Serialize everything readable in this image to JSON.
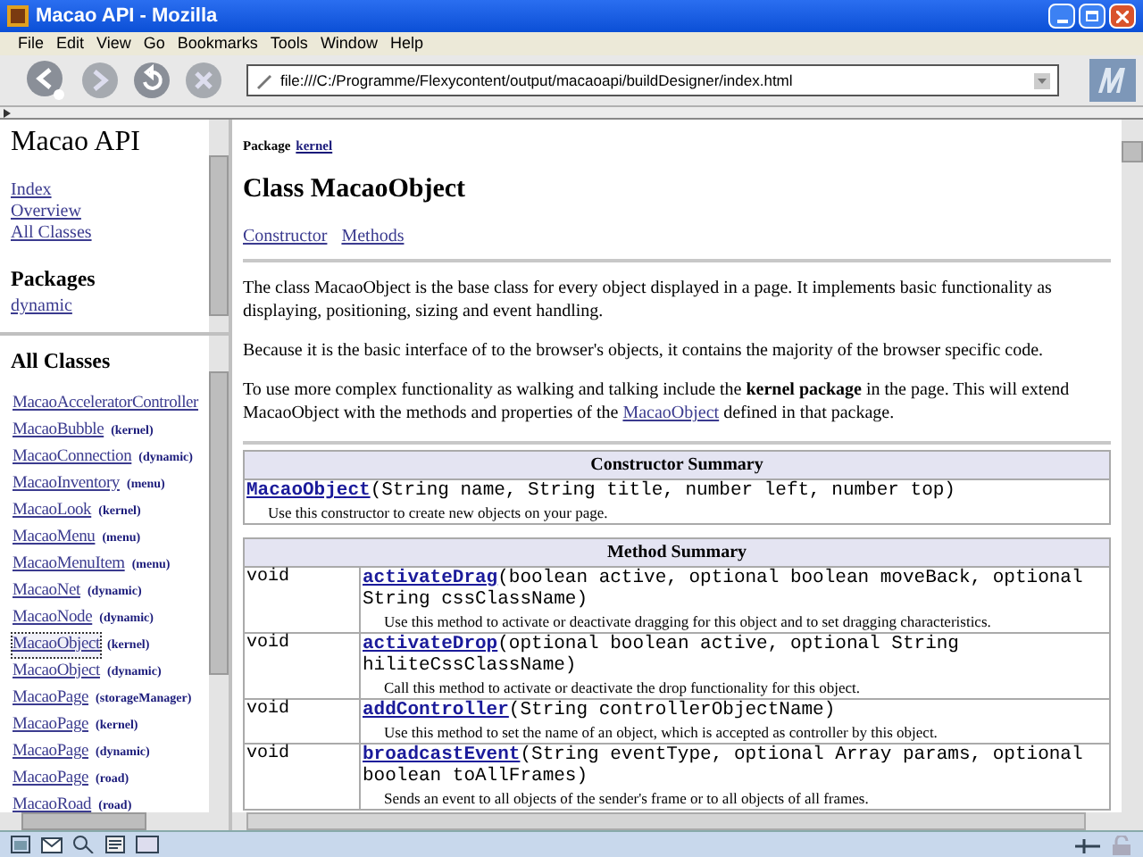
{
  "window": {
    "title": "Macao API - Mozilla"
  },
  "menu": [
    "File",
    "Edit",
    "View",
    "Go",
    "Bookmarks",
    "Tools",
    "Window",
    "Help"
  ],
  "toolbar": {
    "address": "file:///C:/Programme/Flexycontent/output/macaoapi/buildDesigner/index.html"
  },
  "nav_frame": {
    "title": "Macao API",
    "links": [
      "Index",
      "Overview",
      "All Classes"
    ],
    "packages_heading": "Packages",
    "packages": [
      "dynamic"
    ]
  },
  "classes_frame": {
    "heading": "All Classes",
    "classes": [
      {
        "name": "MacaoAcceleratorController",
        "selected": false
      },
      {
        "name": "MacaoBubble",
        "package": "(kernel)",
        "selected": false
      },
      {
        "name": "MacaoConnection",
        "package": "(dynamic)",
        "selected": false
      },
      {
        "name": "MacaoInventory",
        "package": "(menu)",
        "selected": false
      },
      {
        "name": "MacaoLook",
        "package": "(kernel)",
        "selected": false
      },
      {
        "name": "MacaoMenu",
        "package": "(menu)",
        "selected": false
      },
      {
        "name": "MacaoMenuItem",
        "package": "(menu)",
        "selected": false
      },
      {
        "name": "MacaoNet",
        "package": "(dynamic)",
        "selected": false
      },
      {
        "name": "MacaoNode",
        "package": "(dynamic)",
        "selected": false
      },
      {
        "name": "MacaoObject",
        "package": "(kernel)",
        "selected": true
      },
      {
        "name": "MacaoObject",
        "package": "(dynamic)",
        "selected": false
      },
      {
        "name": "MacaoPage",
        "package": "(storageManager)",
        "selected": false
      },
      {
        "name": "MacaoPage",
        "package": "(kernel)",
        "selected": false
      },
      {
        "name": "MacaoPage",
        "package": "(dynamic)",
        "selected": false
      },
      {
        "name": "MacaoPage",
        "package": "(road)",
        "selected": false
      },
      {
        "name": "MacaoRoad",
        "package": "(road)",
        "selected": false
      }
    ]
  },
  "content": {
    "package_label": "Package",
    "package": "kernel",
    "title": "Class MacaoObject",
    "anchors": [
      "Constructor",
      "Methods"
    ],
    "paragraphs": [
      [
        {
          "kind": "text",
          "text": "The class MacaoObject is the base class for every object displayed in a page. It implements basic functionality as displaying, positioning, sizing and event handling."
        }
      ],
      [
        {
          "kind": "text",
          "text": "Because it is the basic interface of to the browser's objects, it contains the majority of the browser specific code."
        }
      ],
      [
        {
          "kind": "text",
          "text": "To use more complex functionality as walking and talking include the **kernel package** in the page. This will extend MacaoObject with the methods and properties of the "
        },
        {
          "kind": "link",
          "text": "MacaoObject"
        },
        {
          "kind": "text",
          "text": " defined in that package."
        }
      ]
    ],
    "constructor_summary": {
      "heading": "Constructor Summary",
      "rows": [
        {
          "name": "MacaoObject",
          "params": "(String name, String title, number left, number top)",
          "description": "Use this constructor to create new objects on your page."
        }
      ]
    },
    "method_summary": {
      "heading": "Method Summary",
      "rows": [
        {
          "type": "void",
          "name": "activateDrag",
          "params": "(boolean active, optional boolean moveBack, optional String cssClassName)",
          "description": "Use this method to activate or deactivate dragging for this object and to set dragging characteristics."
        },
        {
          "type": "void",
          "name": "activateDrop",
          "params": "(optional boolean active, optional String hiliteCssClassName)",
          "description": "Call this method to activate or deactivate the drop functionality for this object."
        },
        {
          "type": "void",
          "name": "addController",
          "params": "(String controllerObjectName)",
          "description": "Use this method to set the name of an object, which is accepted as controller by this object."
        },
        {
          "type": "void",
          "name": "broadcastEvent",
          "params": "(String eventType, optional Array params, optional boolean toAllFrames)",
          "description": "Sends an event to all objects of the sender's frame or to all objects of all frames."
        }
      ]
    }
  }
}
